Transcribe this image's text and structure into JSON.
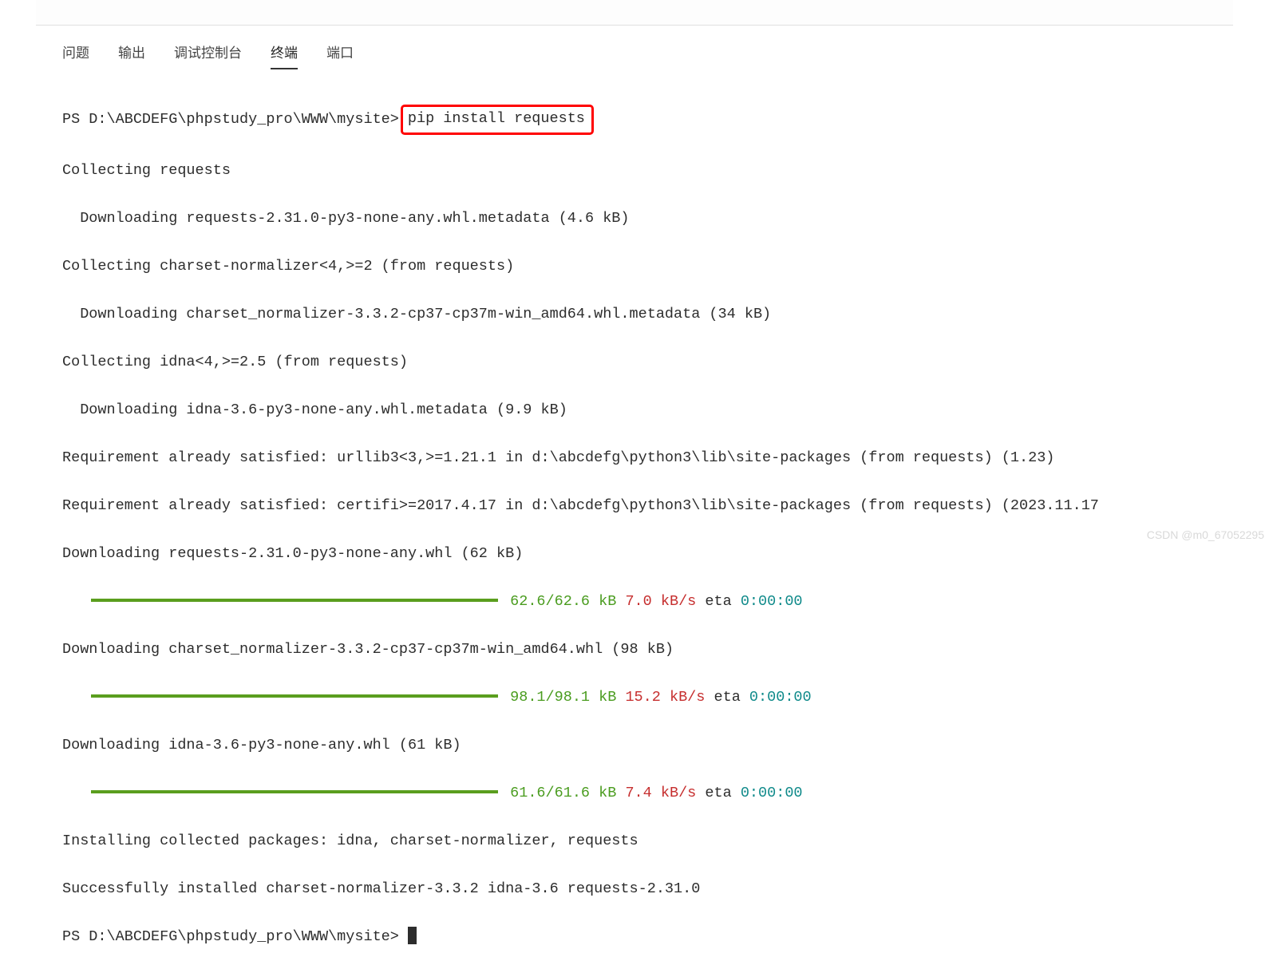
{
  "tabs": {
    "problems": "问题",
    "output": "输出",
    "debug": "调试控制台",
    "terminal": "终端",
    "ports": "端口"
  },
  "terminal": {
    "prompt_path": "PS D:\\ABCDEFG\\phpstudy_pro\\WWW\\mysite>",
    "command": "pip install requests",
    "lines": {
      "l1": "Collecting requests",
      "l2": "  Downloading requests-2.31.0-py3-none-any.whl.metadata (4.6 kB)",
      "l3": "Collecting charset-normalizer<4,>=2 (from requests)",
      "l4": "  Downloading charset_normalizer-3.3.2-cp37-cp37m-win_amd64.whl.metadata (34 kB)",
      "l5": "Collecting idna<4,>=2.5 (from requests)",
      "l6": "  Downloading idna-3.6-py3-none-any.whl.metadata (9.9 kB)",
      "l7": "Requirement already satisfied: urllib3<3,>=1.21.1 in d:\\abcdefg\\python3\\lib\\site-packages (from requests) (1.23)",
      "l8": "Requirement already satisfied: certifi>=2017.4.17 in d:\\abcdefg\\python3\\lib\\site-packages (from requests) (2023.11.17",
      "l9": "Downloading requests-2.31.0-py3-none-any.whl (62 kB)",
      "p1_size": "62.6/62.6 kB",
      "p1_speed": "7.0 kB/s",
      "p1_eta_label": "eta",
      "p1_eta": "0:00:00",
      "l10": "Downloading charset_normalizer-3.3.2-cp37-cp37m-win_amd64.whl (98 kB)",
      "p2_size": "98.1/98.1 kB",
      "p2_speed": "15.2 kB/s",
      "p2_eta_label": "eta",
      "p2_eta": "0:00:00",
      "l11": "Downloading idna-3.6-py3-none-any.whl (61 kB)",
      "p3_size": "61.6/61.6 kB",
      "p3_speed": "7.4 kB/s",
      "p3_eta_label": "eta",
      "p3_eta": "0:00:00",
      "l12": "Installing collected packages: idna, charset-normalizer, requests",
      "l13": "Successfully installed charset-normalizer-3.3.2 idna-3.6 requests-2.31.0"
    }
  },
  "watermark": "CSDN @m0_67052295"
}
